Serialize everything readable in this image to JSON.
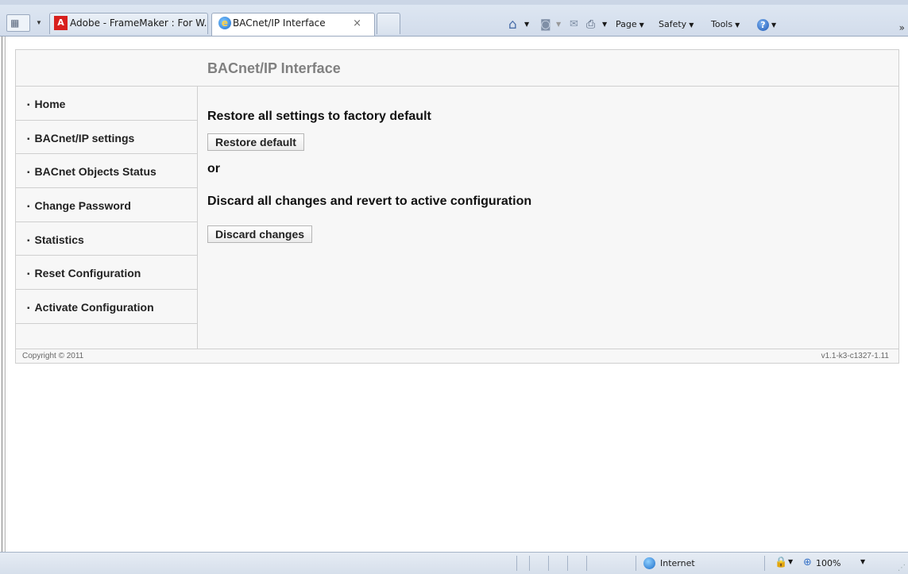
{
  "browser": {
    "tabs": [
      {
        "label": "Adobe - FrameMaker : For W...",
        "icon": "adobe-icon"
      },
      {
        "label": "BACnet/IP Interface",
        "icon": "ie-page-icon",
        "active": true
      }
    ],
    "tab_close_symbol": "×",
    "commands": {
      "page": "Page",
      "safety": "Safety",
      "tools": "Tools"
    },
    "more_symbol": "»"
  },
  "page": {
    "title": "BACnet/IP Interface",
    "sidebar": {
      "items": [
        {
          "label": "Home"
        },
        {
          "label": "BACnet/IP settings"
        },
        {
          "label": "BACnet Objects Status"
        },
        {
          "label": "Change Password"
        },
        {
          "label": "Statistics"
        },
        {
          "label": "Reset Configuration"
        },
        {
          "label": "Activate Configuration"
        }
      ]
    },
    "content": {
      "restore_heading": "Restore all settings to factory default",
      "restore_button": "Restore default",
      "or_text": "or",
      "discard_heading": "Discard all changes and revert to active configuration",
      "discard_button": "Discard changes"
    },
    "footer": {
      "copyright": "Copyright © 2011",
      "version": "v1.1-k3-c1327-1.11"
    }
  },
  "statusbar": {
    "zone": "Internet",
    "zoom": "100%"
  },
  "colors": {
    "panel_background": "#f7f7f7",
    "title_gray": "#808080",
    "border": "#cfcfcf"
  }
}
